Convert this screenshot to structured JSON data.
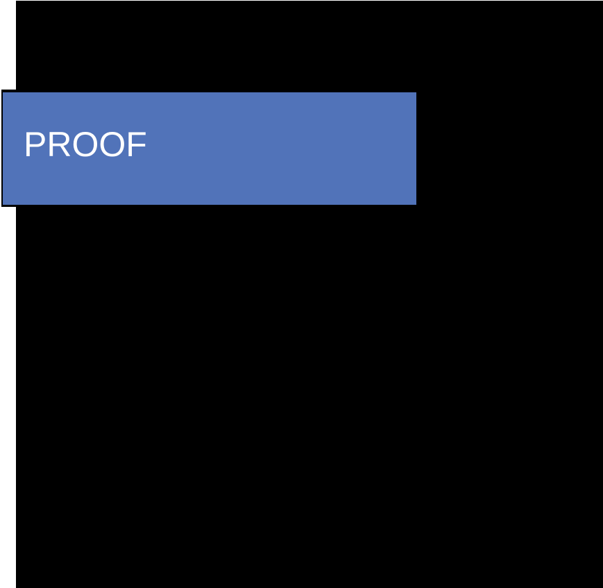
{
  "label": {
    "text": "PROOF"
  },
  "colors": {
    "background": "#ffffff",
    "panel": "#000000",
    "label_fill": "#5173b9",
    "label_text": "#ffffff"
  }
}
